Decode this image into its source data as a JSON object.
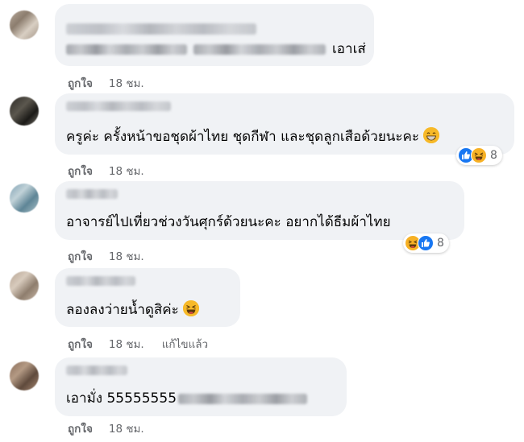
{
  "comments": [
    {
      "text": "เอาเส่",
      "like_label": "ถูกใจ",
      "time": "18 ชม.",
      "avatar_colors": [
        "#b7a99b",
        "#8c7d6e",
        "#d9cfc3",
        "#a39486"
      ]
    },
    {
      "text": "ครูค่ะ ครั้งหน้าขอชุดผ้าไทย ชุดกีฬา และชุดลูกเสือด้วยนะคะ",
      "emoji": "grin-emoji",
      "like_label": "ถูกใจ",
      "time": "18 ชม.",
      "reactions": {
        "icons": [
          "like-icon",
          "haha-icon"
        ],
        "count": "8"
      },
      "avatar_colors": [
        "#2d2a26",
        "#5b574e",
        "#1b1a17",
        "#76736a"
      ]
    },
    {
      "text": "อาจารย์ไปเที่ยวช่วงวันศุกร์ด้วยนะคะ อยากได้ธีมผ้าไทย",
      "like_label": "ถูกใจ",
      "time": "18 ชม.",
      "reactions": {
        "icons": [
          "haha-icon",
          "like-icon"
        ],
        "count": "8"
      },
      "avatar_colors": [
        "#7fa2b4",
        "#c1d2d8",
        "#5e8596",
        "#a9c0c8"
      ]
    },
    {
      "text": "ลองลงว่ายน้ำดูสิค่ะ",
      "emoji": "laughing-emoji",
      "like_label": "ถูกใจ",
      "time": "18 ชม.",
      "edited_label": "แก้ไขแล้ว",
      "avatar_colors": [
        "#b6a493",
        "#d8cbbd",
        "#8e7d6d",
        "#c9b8a7"
      ]
    },
    {
      "text": "เอามั่ง 55555555",
      "like_label": "ถูกใจ",
      "time": "18 ชม.",
      "avatar_colors": [
        "#8a6d5a",
        "#b49a84",
        "#5f4a3c",
        "#a58671"
      ]
    }
  ],
  "colors": {
    "bubble": "#f0f2f5",
    "meta_text": "#65676b",
    "body_text": "#050505",
    "like_blue": "#1877f2",
    "haha_yellow": "#f7b125"
  }
}
